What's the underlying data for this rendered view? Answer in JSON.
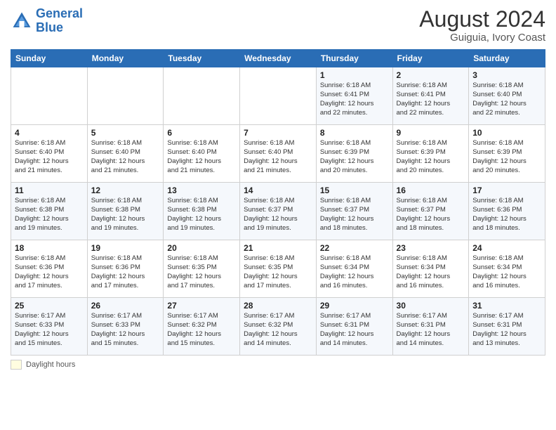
{
  "header": {
    "logo_line1": "General",
    "logo_line2": "Blue",
    "month_title": "August 2024",
    "location": "Guiguia, Ivory Coast"
  },
  "weekdays": [
    "Sunday",
    "Monday",
    "Tuesday",
    "Wednesday",
    "Thursday",
    "Friday",
    "Saturday"
  ],
  "legend": {
    "label": "Daylight hours"
  },
  "weeks": [
    [
      {
        "day": "",
        "info": ""
      },
      {
        "day": "",
        "info": ""
      },
      {
        "day": "",
        "info": ""
      },
      {
        "day": "",
        "info": ""
      },
      {
        "day": "1",
        "info": "Sunrise: 6:18 AM\nSunset: 6:41 PM\nDaylight: 12 hours\nand 22 minutes."
      },
      {
        "day": "2",
        "info": "Sunrise: 6:18 AM\nSunset: 6:41 PM\nDaylight: 12 hours\nand 22 minutes."
      },
      {
        "day": "3",
        "info": "Sunrise: 6:18 AM\nSunset: 6:40 PM\nDaylight: 12 hours\nand 22 minutes."
      }
    ],
    [
      {
        "day": "4",
        "info": "Sunrise: 6:18 AM\nSunset: 6:40 PM\nDaylight: 12 hours\nand 21 minutes."
      },
      {
        "day": "5",
        "info": "Sunrise: 6:18 AM\nSunset: 6:40 PM\nDaylight: 12 hours\nand 21 minutes."
      },
      {
        "day": "6",
        "info": "Sunrise: 6:18 AM\nSunset: 6:40 PM\nDaylight: 12 hours\nand 21 minutes."
      },
      {
        "day": "7",
        "info": "Sunrise: 6:18 AM\nSunset: 6:40 PM\nDaylight: 12 hours\nand 21 minutes."
      },
      {
        "day": "8",
        "info": "Sunrise: 6:18 AM\nSunset: 6:39 PM\nDaylight: 12 hours\nand 20 minutes."
      },
      {
        "day": "9",
        "info": "Sunrise: 6:18 AM\nSunset: 6:39 PM\nDaylight: 12 hours\nand 20 minutes."
      },
      {
        "day": "10",
        "info": "Sunrise: 6:18 AM\nSunset: 6:39 PM\nDaylight: 12 hours\nand 20 minutes."
      }
    ],
    [
      {
        "day": "11",
        "info": "Sunrise: 6:18 AM\nSunset: 6:38 PM\nDaylight: 12 hours\nand 19 minutes."
      },
      {
        "day": "12",
        "info": "Sunrise: 6:18 AM\nSunset: 6:38 PM\nDaylight: 12 hours\nand 19 minutes."
      },
      {
        "day": "13",
        "info": "Sunrise: 6:18 AM\nSunset: 6:38 PM\nDaylight: 12 hours\nand 19 minutes."
      },
      {
        "day": "14",
        "info": "Sunrise: 6:18 AM\nSunset: 6:37 PM\nDaylight: 12 hours\nand 19 minutes."
      },
      {
        "day": "15",
        "info": "Sunrise: 6:18 AM\nSunset: 6:37 PM\nDaylight: 12 hours\nand 18 minutes."
      },
      {
        "day": "16",
        "info": "Sunrise: 6:18 AM\nSunset: 6:37 PM\nDaylight: 12 hours\nand 18 minutes."
      },
      {
        "day": "17",
        "info": "Sunrise: 6:18 AM\nSunset: 6:36 PM\nDaylight: 12 hours\nand 18 minutes."
      }
    ],
    [
      {
        "day": "18",
        "info": "Sunrise: 6:18 AM\nSunset: 6:36 PM\nDaylight: 12 hours\nand 17 minutes."
      },
      {
        "day": "19",
        "info": "Sunrise: 6:18 AM\nSunset: 6:36 PM\nDaylight: 12 hours\nand 17 minutes."
      },
      {
        "day": "20",
        "info": "Sunrise: 6:18 AM\nSunset: 6:35 PM\nDaylight: 12 hours\nand 17 minutes."
      },
      {
        "day": "21",
        "info": "Sunrise: 6:18 AM\nSunset: 6:35 PM\nDaylight: 12 hours\nand 17 minutes."
      },
      {
        "day": "22",
        "info": "Sunrise: 6:18 AM\nSunset: 6:34 PM\nDaylight: 12 hours\nand 16 minutes."
      },
      {
        "day": "23",
        "info": "Sunrise: 6:18 AM\nSunset: 6:34 PM\nDaylight: 12 hours\nand 16 minutes."
      },
      {
        "day": "24",
        "info": "Sunrise: 6:18 AM\nSunset: 6:34 PM\nDaylight: 12 hours\nand 16 minutes."
      }
    ],
    [
      {
        "day": "25",
        "info": "Sunrise: 6:17 AM\nSunset: 6:33 PM\nDaylight: 12 hours\nand 15 minutes."
      },
      {
        "day": "26",
        "info": "Sunrise: 6:17 AM\nSunset: 6:33 PM\nDaylight: 12 hours\nand 15 minutes."
      },
      {
        "day": "27",
        "info": "Sunrise: 6:17 AM\nSunset: 6:32 PM\nDaylight: 12 hours\nand 15 minutes."
      },
      {
        "day": "28",
        "info": "Sunrise: 6:17 AM\nSunset: 6:32 PM\nDaylight: 12 hours\nand 14 minutes."
      },
      {
        "day": "29",
        "info": "Sunrise: 6:17 AM\nSunset: 6:31 PM\nDaylight: 12 hours\nand 14 minutes."
      },
      {
        "day": "30",
        "info": "Sunrise: 6:17 AM\nSunset: 6:31 PM\nDaylight: 12 hours\nand 14 minutes."
      },
      {
        "day": "31",
        "info": "Sunrise: 6:17 AM\nSunset: 6:31 PM\nDaylight: 12 hours\nand 13 minutes."
      }
    ]
  ]
}
